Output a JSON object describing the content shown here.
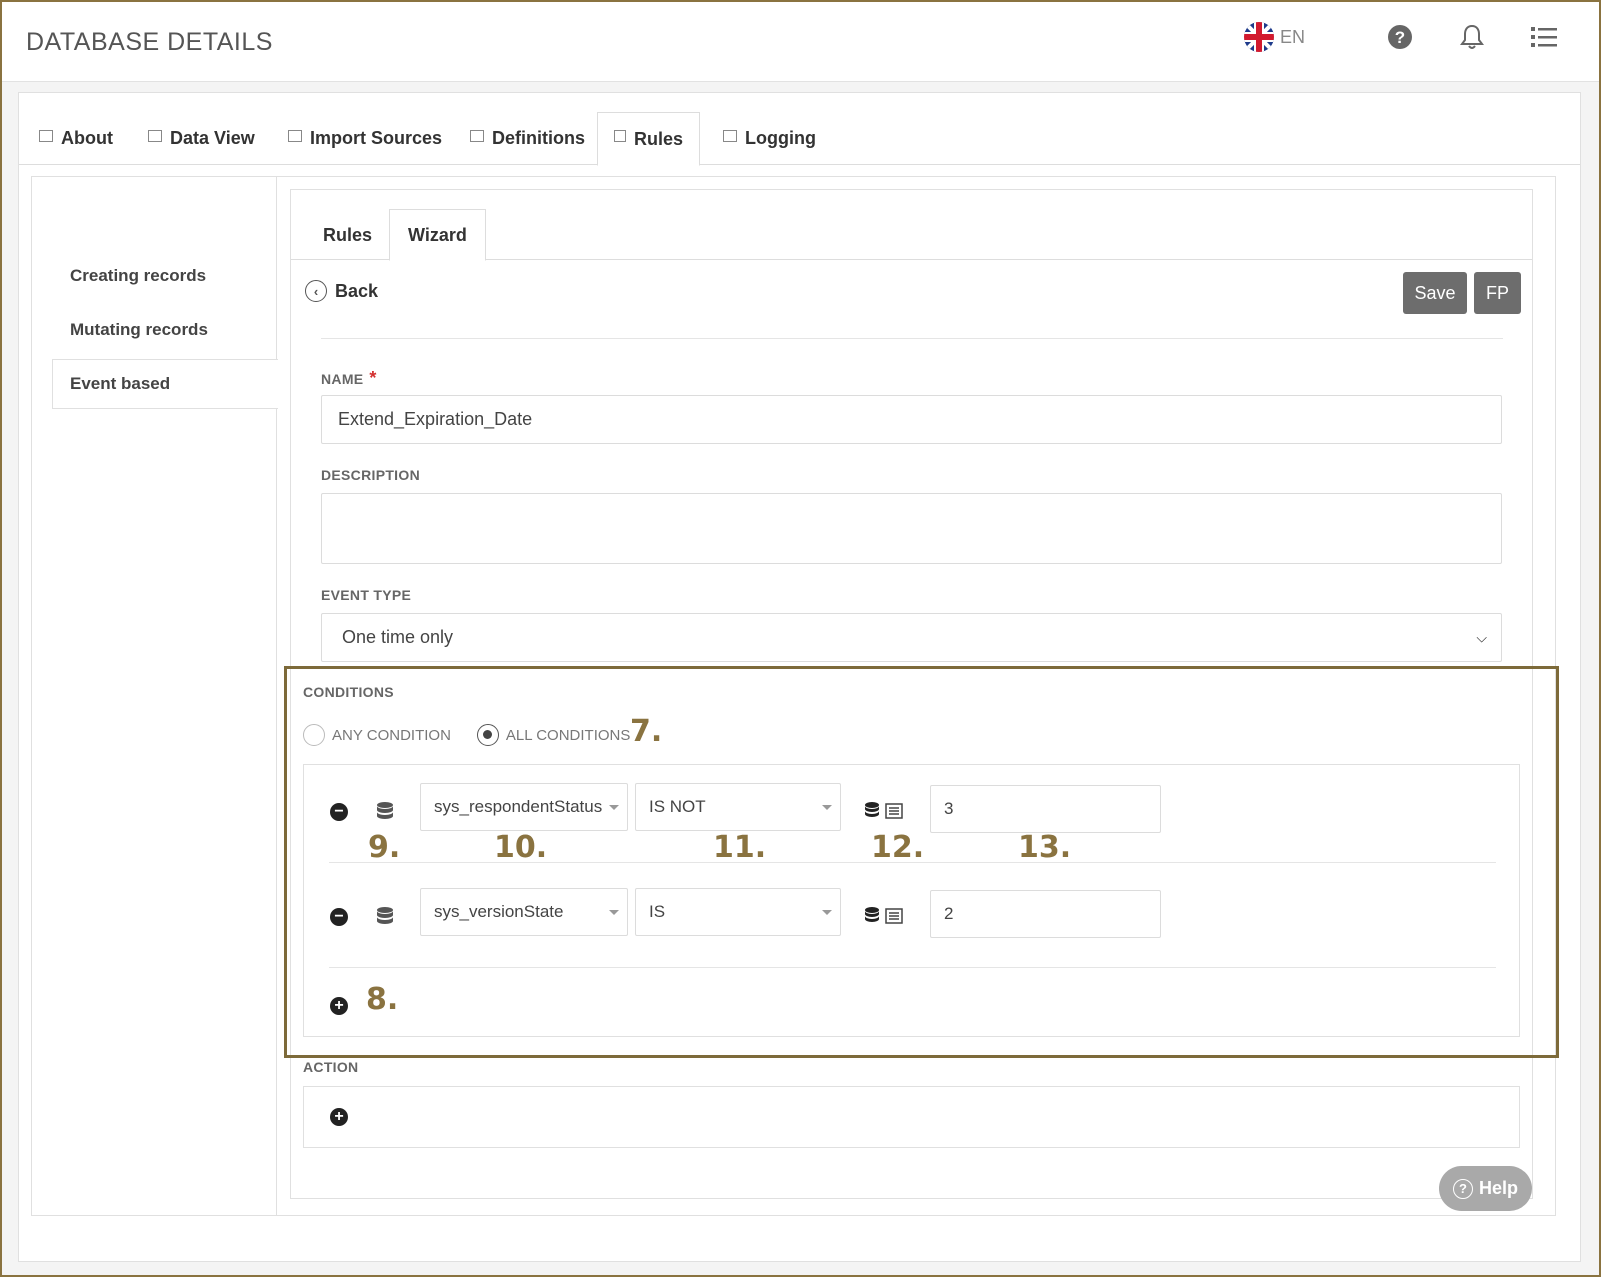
{
  "header": {
    "title": "DATABASE DETAILS",
    "language": "EN"
  },
  "tabs": [
    {
      "label": "About"
    },
    {
      "label": "Data View"
    },
    {
      "label": "Import Sources"
    },
    {
      "label": "Definitions"
    },
    {
      "label": "Rules",
      "active": true
    },
    {
      "label": "Logging"
    }
  ],
  "sidenav": {
    "items": [
      {
        "label": "Creating records"
      },
      {
        "label": "Mutating records"
      },
      {
        "label": "Event based",
        "active": true
      }
    ]
  },
  "subtabs": [
    {
      "label": "Rules"
    },
    {
      "label": "Wizard",
      "active": true
    }
  ],
  "toolbar": {
    "back_label": "Back",
    "save_label": "Save",
    "fp_label": "FP"
  },
  "form": {
    "name_label": "NAME",
    "name_required_mark": "*",
    "name_value": "Extend_Expiration_Date",
    "description_label": "DESCRIPTION",
    "description_value": "",
    "event_type_label": "EVENT TYPE",
    "event_type_value": "One time only"
  },
  "conditions": {
    "label": "CONDITIONS",
    "any_label": "ANY CONDITION",
    "all_label": "ALL CONDITIONS",
    "selected": "all",
    "rows": [
      {
        "field": "sys_respondentStatus",
        "operator": "IS NOT",
        "value": "3"
      },
      {
        "field": "sys_versionState",
        "operator": "IS",
        "value": "2"
      }
    ]
  },
  "action": {
    "label": "ACTION"
  },
  "help": {
    "label": "Help"
  },
  "annotations": {
    "n7": "7.",
    "n8": "8.",
    "n9": "9.",
    "n10": "10.",
    "n11": "11.",
    "n12": "12.",
    "n13": "13."
  },
  "colors": {
    "annotation": "#8a7340",
    "button_dark": "#6d6d6d",
    "required": "#d32f2f"
  }
}
